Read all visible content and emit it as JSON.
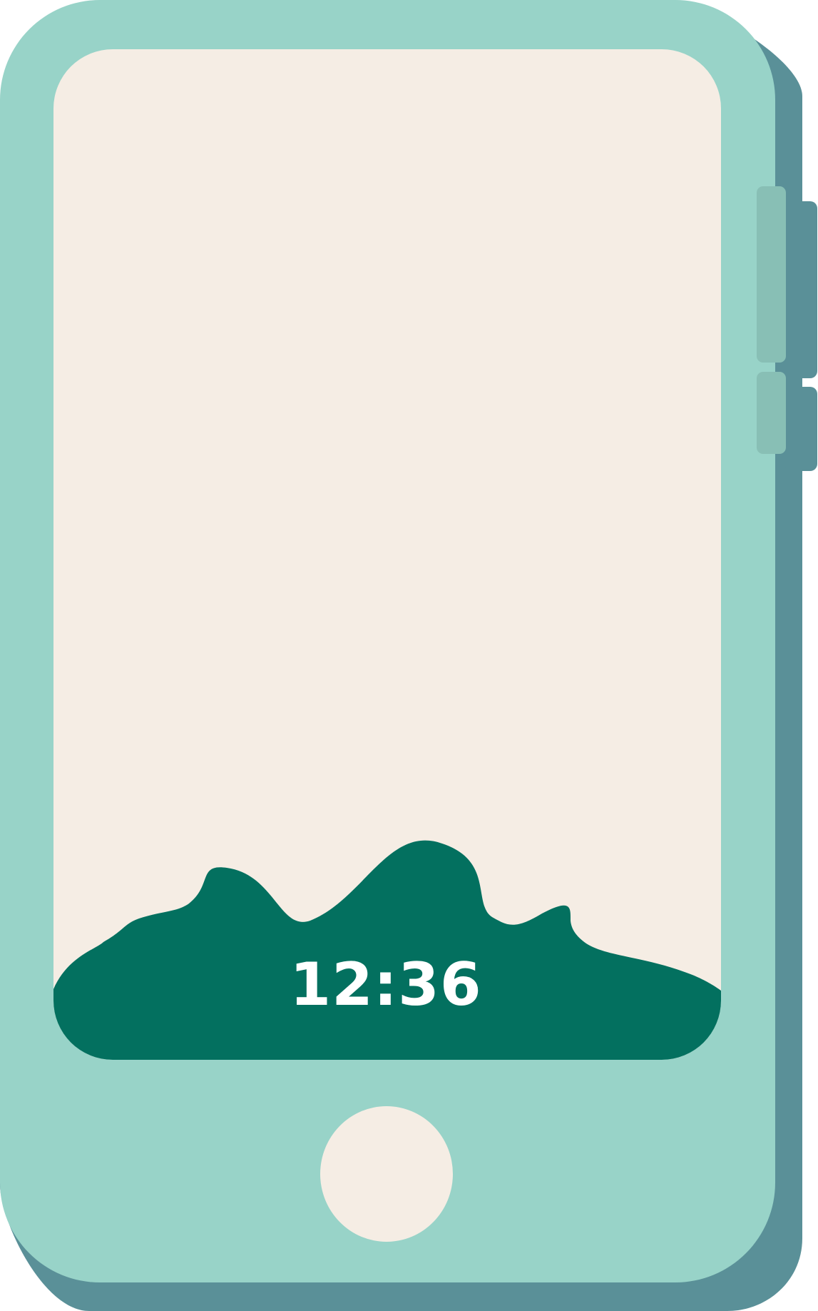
{
  "screen": {
    "clock_time": "12:36"
  },
  "colors": {
    "phone_body": "#98d3c8",
    "phone_shadow": "#5a9098",
    "screen_background": "#f5ede4",
    "landscape_fill": "#03705f",
    "side_button": "#88bfb5",
    "home_button": "#f5ede4",
    "clock_text": "#ffffff"
  },
  "icons": {
    "home_button": "home-button-icon",
    "volume_up": "volume-up-button",
    "volume_down": "volume-down-button"
  }
}
